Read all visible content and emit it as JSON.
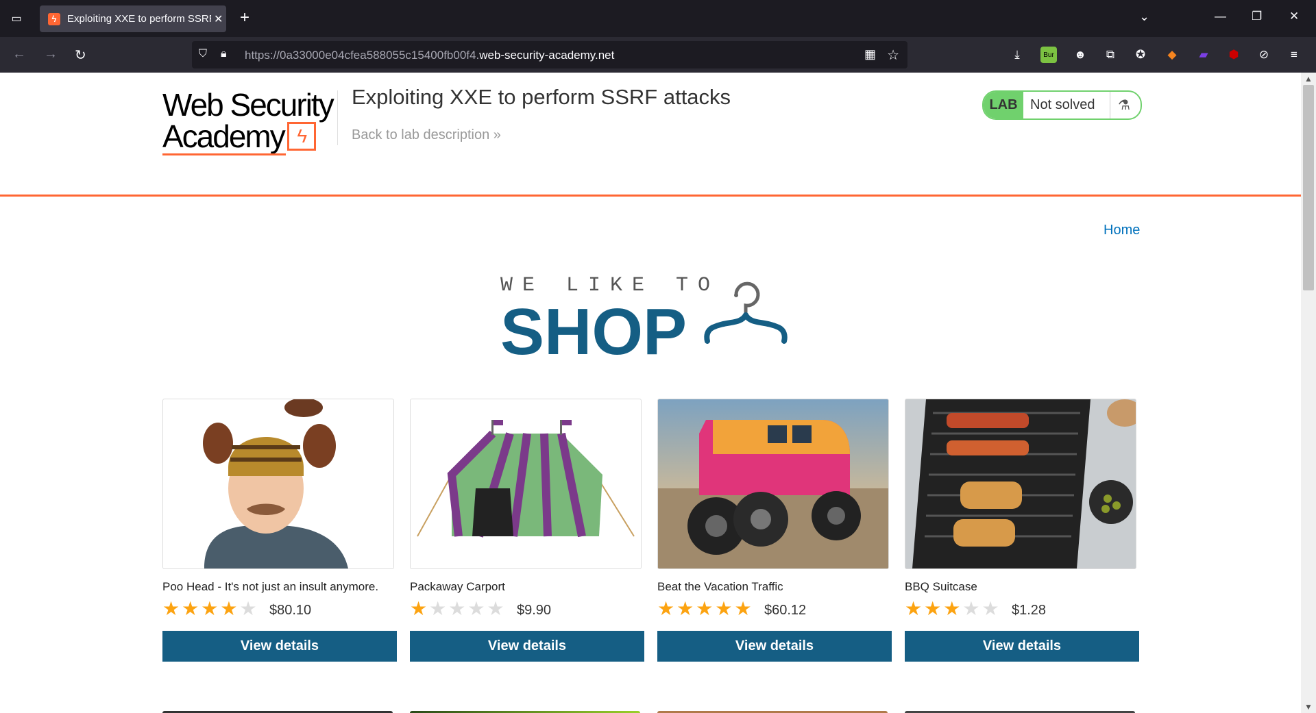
{
  "browser": {
    "tab_title": "Exploiting XXE to perform SSRF",
    "url_prefix": "https://0a33000e04cfea588055c15400fb00f4.",
    "url_domain": "web-security-academy.net"
  },
  "header": {
    "logo_line1": "Web Security",
    "logo_line2": "Academy",
    "lab_title": "Exploiting XXE to perform SSRF attacks",
    "back_link": "Back to lab description",
    "back_chevrons": "»",
    "lab_tag": "LAB",
    "lab_status": "Not solved"
  },
  "nav": {
    "home": "Home"
  },
  "hero": {
    "tagline": "WE LIKE TO",
    "shop": "SHOP"
  },
  "products": [
    {
      "name": "Poo Head - It's not just an insult anymore.",
      "rating": 4,
      "price": "$80.10",
      "button": "View details"
    },
    {
      "name": "Packaway Carport",
      "rating": 1,
      "price": "$9.90",
      "button": "View details"
    },
    {
      "name": "Beat the Vacation Traffic",
      "rating": 5,
      "price": "$60.12",
      "button": "View details"
    },
    {
      "name": "BBQ Suitcase",
      "rating": 3,
      "price": "$1.28",
      "button": "View details"
    }
  ],
  "colors": {
    "accent": "#ff6633",
    "primary": "#155e84",
    "lab_green": "#70d16d",
    "star": "#fca311"
  }
}
